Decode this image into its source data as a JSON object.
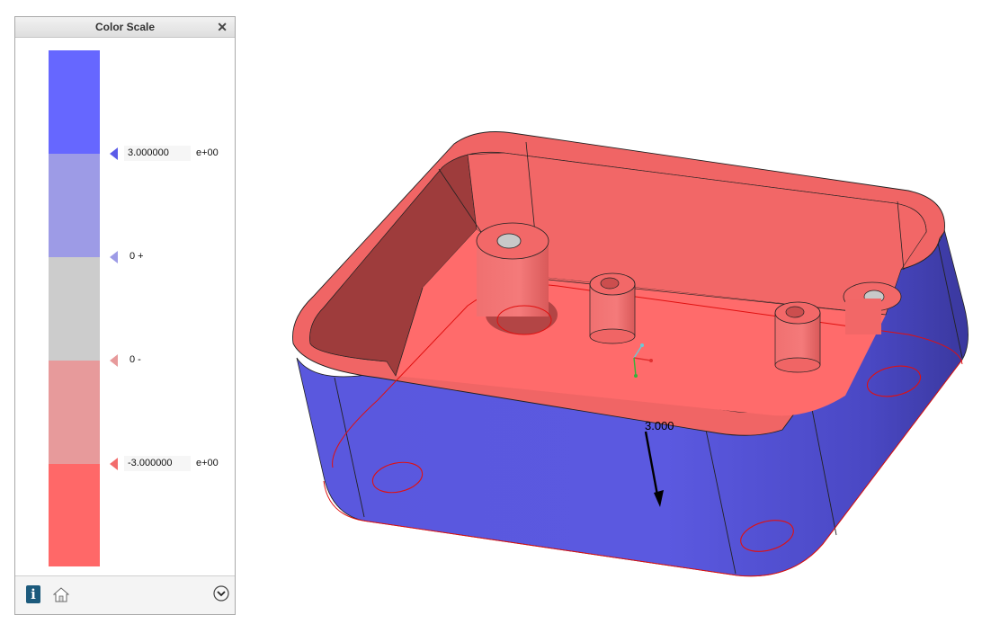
{
  "panel": {
    "title": "Color Scale",
    "close_glyph": "✕",
    "scale": [
      {
        "color": "#6667ff"
      },
      {
        "color": "#9d9be6"
      },
      {
        "color": "#cccccc"
      },
      {
        "color": "#e79a9b"
      },
      {
        "color": "#ff6868"
      }
    ],
    "max_value": "3.000000",
    "max_exp": "e+00",
    "zero_plus": "0 +",
    "zero_minus": "0 -",
    "min_value": "-3.000000",
    "min_exp": "e+00",
    "info_icon": "info-icon",
    "home_icon": "home-icon",
    "expand_icon": "chevron-down-icon"
  },
  "viewport": {
    "dimension_value": "3.000",
    "colors": {
      "inside": "#f06565",
      "outside": "#5b59e0",
      "outline": "#e01010"
    }
  }
}
